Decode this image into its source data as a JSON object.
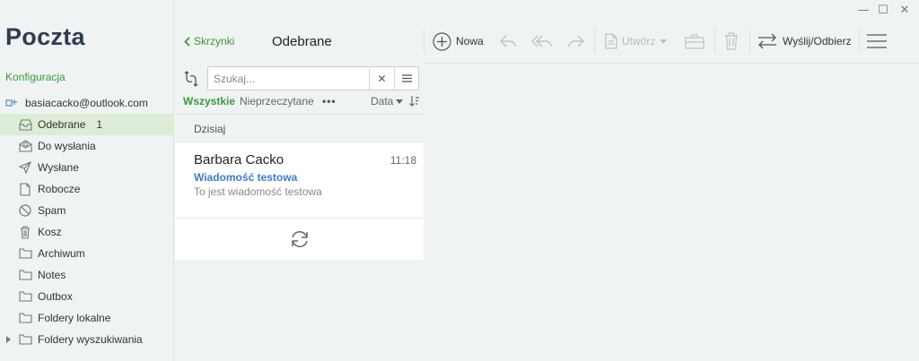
{
  "window": {
    "controls": {
      "minimize": "—",
      "maximize": "☐",
      "close": "✕"
    }
  },
  "app": {
    "title": "Poczta"
  },
  "sidebar": {
    "config_label": "Konfiguracja",
    "account": "basiacacko@outlook.com",
    "folders": [
      {
        "label": "Odebrane",
        "count": "1",
        "icon": "inbox-icon",
        "active": true
      },
      {
        "label": "Do wysłania",
        "count": "",
        "icon": "outbox-icon"
      },
      {
        "label": "Wysłane",
        "count": "",
        "icon": "sent-icon"
      },
      {
        "label": "Robocze",
        "count": "",
        "icon": "draft-icon"
      },
      {
        "label": "Spam",
        "count": "",
        "icon": "spam-icon"
      },
      {
        "label": "Kosz",
        "count": "",
        "icon": "trash-icon"
      },
      {
        "label": "Archiwum",
        "count": "",
        "icon": "folder-icon"
      },
      {
        "label": "Notes",
        "count": "",
        "icon": "folder-icon"
      },
      {
        "label": "Outbox",
        "count": "",
        "icon": "folder-icon"
      },
      {
        "label": "Foldery lokalne",
        "count": "",
        "icon": "folder-icon"
      },
      {
        "label": "Foldery wyszukiwania",
        "count": "",
        "icon": "folder-icon",
        "expandable": true
      }
    ]
  },
  "toolbar": {
    "back_label": "Skrzynki",
    "folder_title": "Odebrane",
    "new_label": "Nowa",
    "create_label": "Utwórz",
    "send_receive_label": "Wyślij/Odbierz"
  },
  "list": {
    "search_placeholder": "Szukaj...",
    "filter_all": "Wszystkie",
    "filter_unread": "Nieprzeczytane",
    "more_label": "•••",
    "sort_label": "Data",
    "group_header": "Dzisiaj",
    "messages": [
      {
        "from": "Barbara Cacko",
        "time": "11:18",
        "subject": "Wiadomość testowa",
        "preview": "To jest wiadomość testowa"
      }
    ]
  },
  "colors": {
    "accent_green": "#3a9a3a",
    "subject_blue": "#3a7bc8",
    "active_folder_bg": "#dcecd6"
  }
}
